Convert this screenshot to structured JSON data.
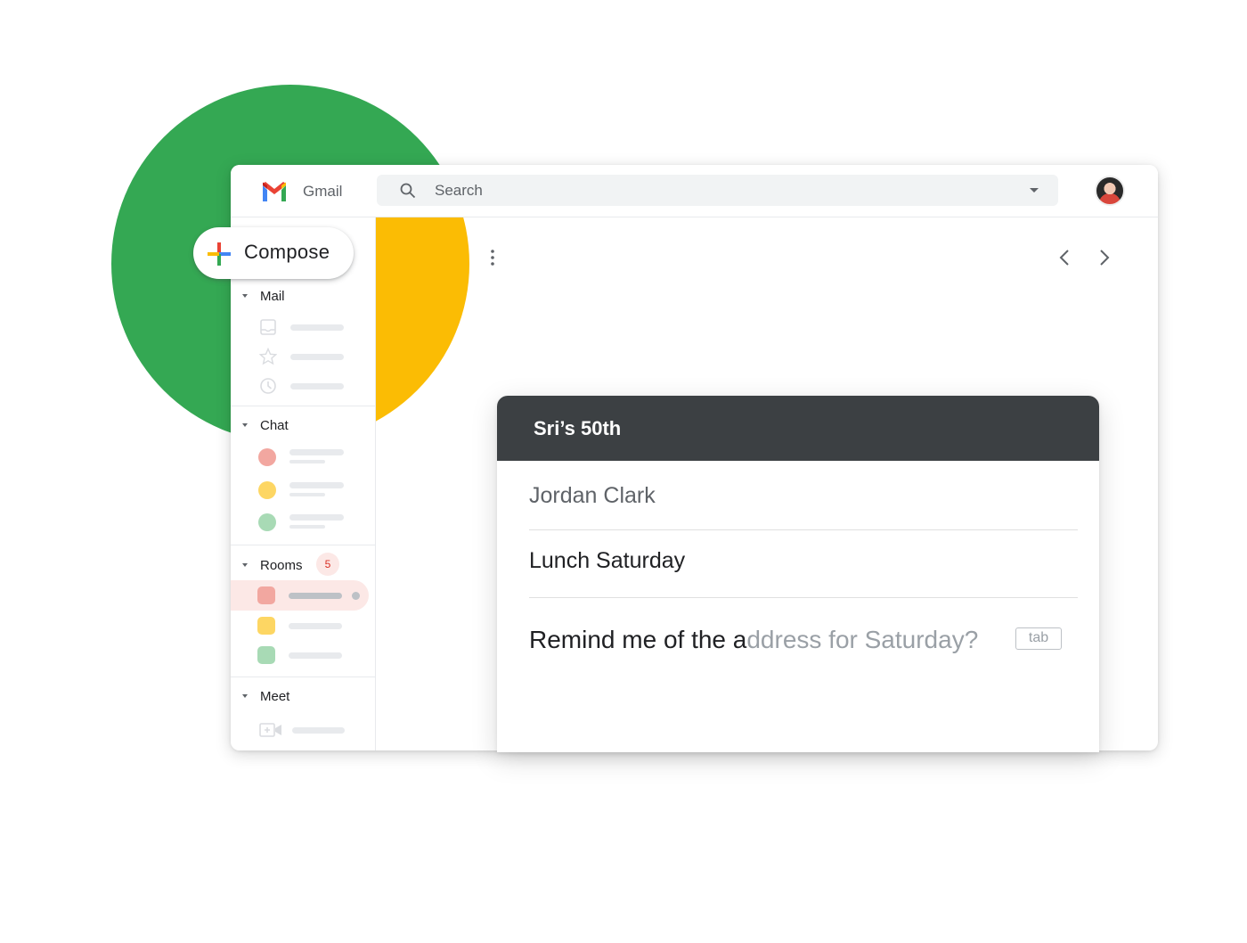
{
  "app": {
    "brand": "Gmail",
    "colors": {
      "green": "#34a853",
      "yellow": "#fbbc04",
      "red": "#ea4335",
      "blue": "#4285f4",
      "dark_header": "#3c4043",
      "badge": "#d93025"
    }
  },
  "header": {
    "search": {
      "placeholder": "Search"
    },
    "icons": [
      "gmail-logo",
      "search-icon",
      "dropdown-caret-icon",
      "avatar"
    ]
  },
  "compose": {
    "label": "Compose"
  },
  "sidebar": {
    "sections": [
      {
        "label": "Mail",
        "items": [
          "inbox-icon",
          "star-icon",
          "clock-icon"
        ]
      },
      {
        "label": "Chat",
        "items": [
          "contact-red",
          "contact-yellow",
          "contact-green"
        ]
      },
      {
        "label": "Rooms",
        "badge": "5",
        "items": [
          "room-red",
          "room-yellow",
          "room-green"
        ]
      },
      {
        "label": "Meet",
        "items": [
          "video-icon"
        ]
      }
    ]
  },
  "toolbar": {
    "icons": [
      "more-vert-icon",
      "chevron-left-icon",
      "chevron-right-icon"
    ]
  },
  "compose_window": {
    "title": "Sri’s 50th",
    "to": "Jordan Clark",
    "subject": "Lunch Saturday",
    "body_typed": "Remind me of the a",
    "body_suggestion": "ddress for Saturday?",
    "accept_hint": "tab"
  }
}
